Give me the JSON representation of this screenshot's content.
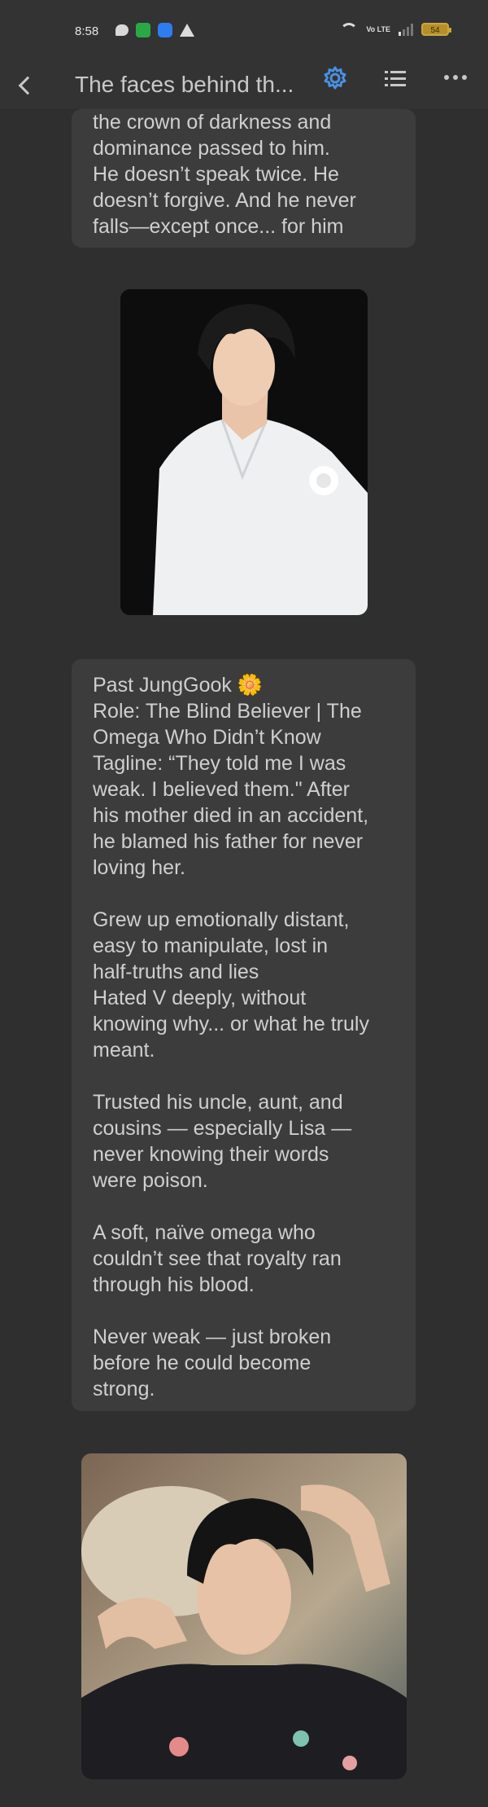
{
  "status_bar": {
    "time": "8:58",
    "volte": "Vo LTE",
    "battery": "54",
    "icons": [
      "chat-icon",
      "app-green-icon",
      "app-blue-icon",
      "warning-icon",
      "wifi-icon",
      "volte-icon",
      "signal-icon",
      "battery-icon"
    ]
  },
  "app_bar": {
    "title": "The faces behind th...",
    "icons": [
      "back-icon",
      "gear-icon",
      "list-icon",
      "more-icon"
    ],
    "accent_color": "#4a90e2"
  },
  "cards": {
    "intro": {
      "text": "the crown of darkness and\ndominance passed to him.\nHe doesn’t speak twice. He\ndoesn’t forgive. And he never\nfalls—except once... for him"
    },
    "past_jungkook": {
      "p1": "Past JungGook 🌼\nRole: The Blind Believer | The\nOmega Who Didn’t Know\nTagline: “They told me I was\nweak. I believed them.\" After\nhis mother died in an accident,\nhe blamed his father for never\nloving her.",
      "p2": "Grew up emotionally distant,\neasy to manipulate, lost in\nhalf-truths and lies\nHated V deeply, without\nknowing why... or what he truly\nmeant.",
      "p3": "Trusted his uncle, aunt, and\ncousins — especially Lisa —\nnever knowing their words\nwere poison.",
      "p4": "A soft, naïve omega who\ncouldn’t see that royalty ran\nthrough his blood.",
      "p5": "Never weak — just broken\nbefore he could become\nstrong."
    }
  },
  "colors": {
    "background": "#2f2f2f",
    "card": "#3c3c3c",
    "text": "#cfcfcf"
  }
}
